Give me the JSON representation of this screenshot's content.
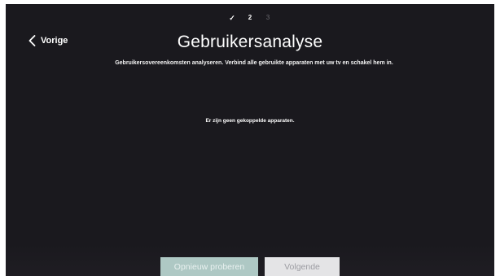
{
  "progress": {
    "steps": [
      {
        "label": "✓",
        "state": "done"
      },
      {
        "label": "2",
        "state": "current"
      },
      {
        "label": "3",
        "state": "pending"
      }
    ]
  },
  "header": {
    "back_label": "Vorige",
    "back_icon": "chevron-left-icon",
    "title": "Gebruikersanalyse",
    "subtitle": "Gebruikersovereenkomsten analyseren. Verbind alle gebruikte apparaten met uw tv en schakel hem in."
  },
  "main": {
    "empty_message": "Er zijn geen gekoppelde apparaten."
  },
  "footer": {
    "retry_label": "Opnieuw proberen",
    "next_label": "Volgende"
  },
  "colors": {
    "background": "#1a191e",
    "retry_button": "#aec8c4",
    "next_button": "#e4e4e6"
  }
}
